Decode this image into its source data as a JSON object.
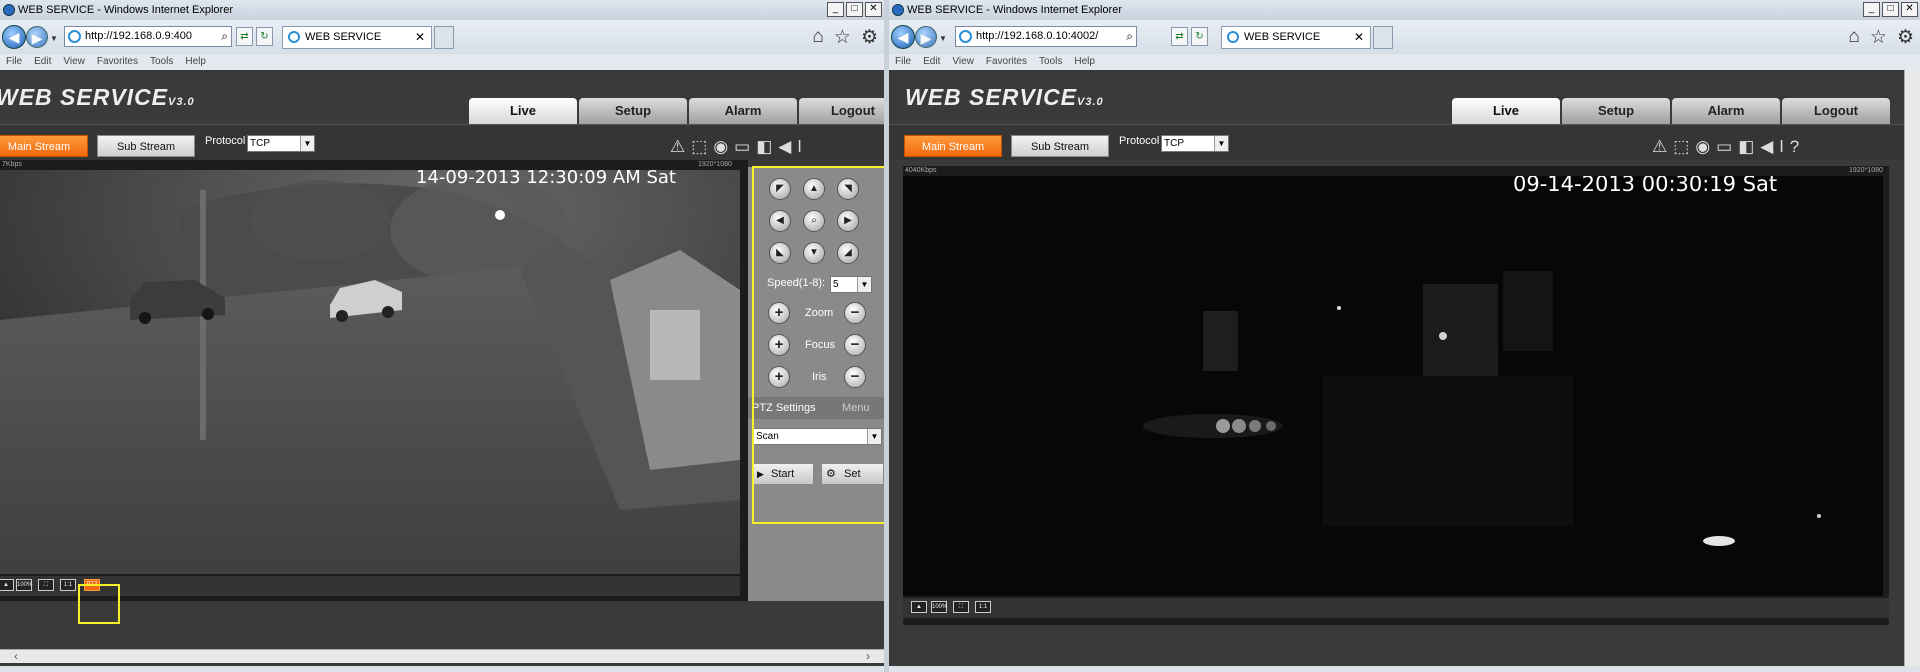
{
  "colors": {
    "accent_orange": "#f0690a",
    "highlight_yellow": "#f6f02a",
    "app_bg": "#3a3a3a"
  },
  "left": {
    "window_title": "WEB SERVICE - Windows Internet Explorer",
    "url": "http://192.168.0.9:400",
    "tab_label": "WEB SERVICE",
    "menu": [
      "File",
      "Edit",
      "View",
      "Favorites",
      "Tools",
      "Help"
    ],
    "logo": "WEB  SERVICE",
    "logo_version": "V3.0",
    "nav_tabs": [
      "Live",
      "Setup",
      "Alarm",
      "Logout"
    ],
    "main_stream": "Main Stream",
    "sub_stream": "Sub Stream",
    "protocol_label": "Protocol",
    "protocol_value": "TCP",
    "bitrate": "7Kbps",
    "resolution": "1920*1080",
    "osd_time": "14-09-2013 12:30:09 AM Sat",
    "video_bar": [
      "▲",
      "100%",
      "⛶",
      "1:1",
      "PTZ"
    ],
    "ptz": {
      "speed_label": "Speed(1-8):",
      "speed_value": "5",
      "zoom": "Zoom",
      "focus": "Focus",
      "iris": "Iris",
      "settings": "PTZ Settings",
      "menu": "Menu",
      "mode": "Scan",
      "start": "Start",
      "set": "Set"
    }
  },
  "right": {
    "window_title": "WEB SERVICE - Windows Internet Explorer",
    "url": "http://192.168.0.10:4002/",
    "tab_label": "WEB SERVICE",
    "menu": [
      "File",
      "Edit",
      "View",
      "Favorites",
      "Tools",
      "Help"
    ],
    "logo": "WEB  SERVICE",
    "logo_version": "V3.0",
    "nav_tabs": [
      "Live",
      "Setup",
      "Alarm",
      "Logout"
    ],
    "main_stream": "Main Stream",
    "sub_stream": "Sub Stream",
    "protocol_label": "Protocol",
    "protocol_value": "TCP",
    "bitrate": "4040Kbps",
    "resolution": "1920*1080",
    "osd_time": "09-14-2013 00:30:19 Sat",
    "video_bar": [
      "▲",
      "100%",
      "⛶",
      "1:1"
    ]
  }
}
